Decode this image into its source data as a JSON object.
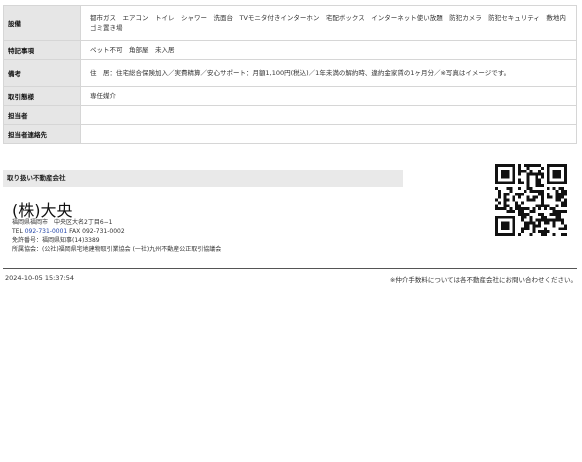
{
  "details": {
    "rows": [
      {
        "label": "設備",
        "value": "都市ガス　エアコン　トイレ　シャワー　洗面台　TVモニタ付きインターホン　宅配ボックス　インターネット使い放題　防犯カメラ　防犯セキュリティ　敷地内ゴミ置き場"
      },
      {
        "label": "特記事項",
        "value": "ペット不可　角部屋　未入居"
      },
      {
        "label": "備考",
        "value": "住　居：住宅総合保険加入／実費精算／安心サポート：月額1,100円(税込)／1年未満の解約時、違約金家賃の1ヶ月分／※写真はイメージです。"
      },
      {
        "label": "取引態様",
        "value": "専任媒介"
      },
      {
        "label": "担当者",
        "value": ""
      },
      {
        "label": "担当者連絡先",
        "value": ""
      }
    ]
  },
  "company": {
    "heading": "取り扱い不動産会社",
    "name": "(株)大央",
    "address": "福岡県福岡市　中央区大名2丁目6−1",
    "tel_label": "TEL ",
    "tel": "092-731-0001",
    "fax": " FAX 092-731-0002",
    "license": "免許番号：福岡県知事(14)3389",
    "association": "所属協会：(公社)福岡県宅地建物取引業協会 (一社)九州不動産公正取引協議会"
  },
  "footer": {
    "timestamp": "2024-10-05 15:37:54",
    "note": "※仲介手数料については各不動産会社にお問い合わせください。"
  }
}
